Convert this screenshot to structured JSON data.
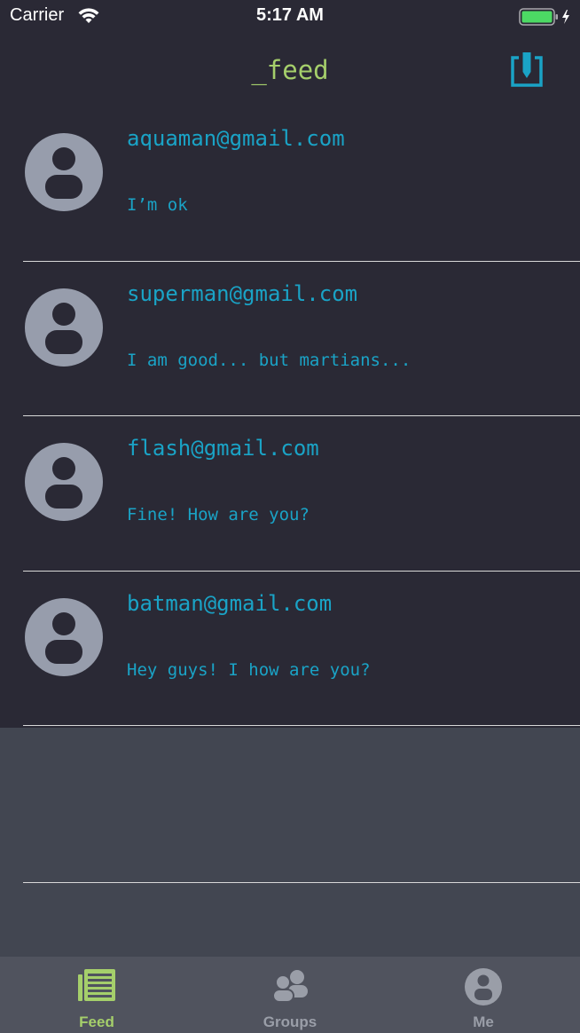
{
  "status_bar": {
    "carrier": "Carrier",
    "time": "5:17 AM",
    "wifi_icon": "wifi-icon",
    "battery_icon": "battery-icon",
    "battery_level": 1.0
  },
  "nav": {
    "title": "_feed",
    "compose_icon": "compose-icon"
  },
  "feed": [
    {
      "email": "aquaman@gmail.com",
      "message": "I’m ok"
    },
    {
      "email": "superman@gmail.com",
      "message": "I am good... but martians..."
    },
    {
      "email": "flash@gmail.com",
      "message": "Fine! How are you?"
    },
    {
      "email": "batman@gmail.com",
      "message": "Hey guys! I how are you?"
    }
  ],
  "tabs": [
    {
      "label": "Feed",
      "icon": "feed-icon",
      "selected": true
    },
    {
      "label": "Groups",
      "icon": "groups-icon",
      "selected": false
    },
    {
      "label": "Me",
      "icon": "me-icon",
      "selected": false
    }
  ],
  "colors": {
    "bar_background": "#2a2935",
    "list_background": "#2a2935",
    "empty_background": "#424651",
    "tab_bar_background": "#50535e",
    "title": "#a5cf6b",
    "text_accent": "#1aa3c6",
    "tab_active": "#a5cf6b",
    "tab_inactive": "#9a9ea8",
    "avatar": "#979dac"
  }
}
